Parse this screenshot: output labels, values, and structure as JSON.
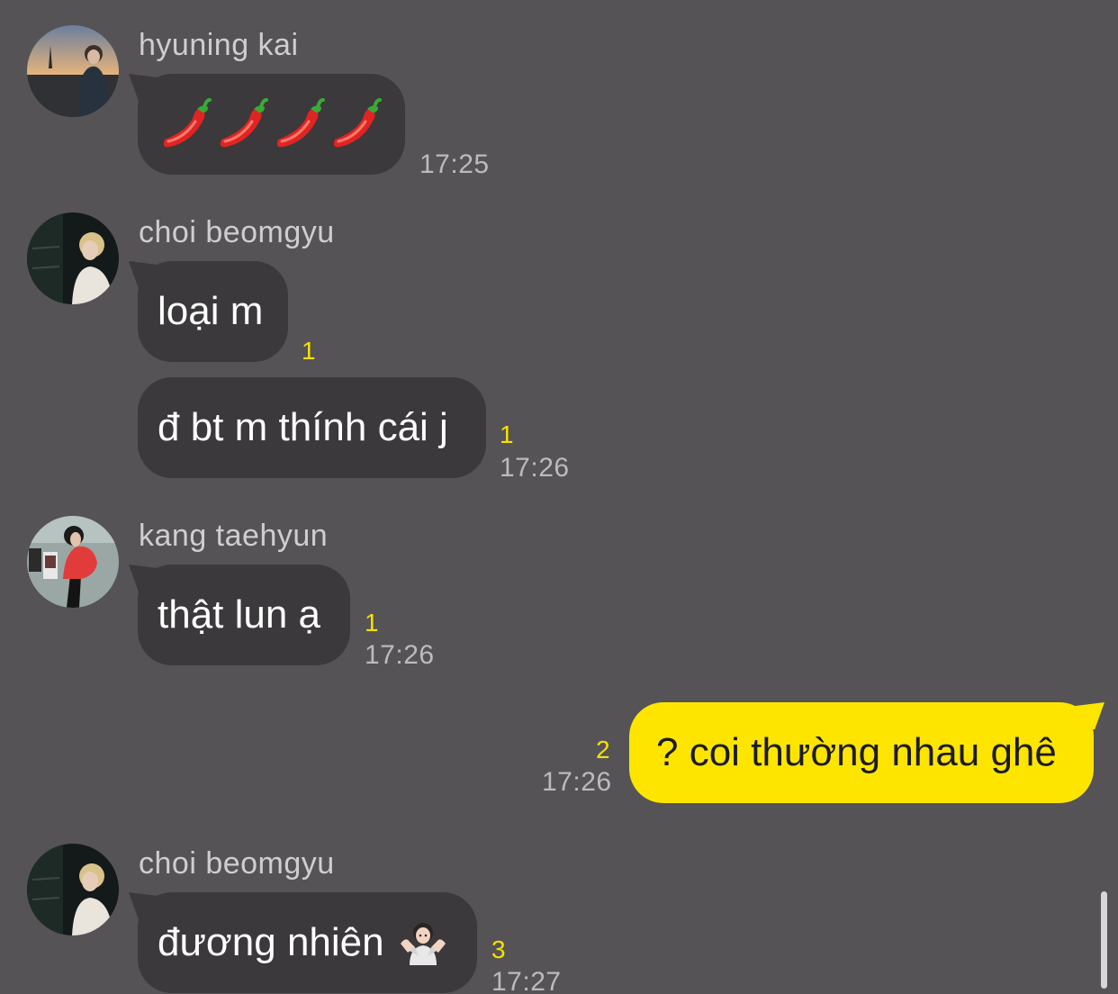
{
  "messages": [
    {
      "sender": "hyuning kai",
      "avatar_icon": "avatar-photo-icon",
      "bubbles": [
        {
          "text": "🌶️🌶️🌶️🌶️",
          "emoji": "chili-pepper-icon",
          "emoji_count": 4,
          "unread": "",
          "time": "17:25"
        }
      ]
    },
    {
      "sender": "choi beomgyu",
      "avatar_icon": "avatar-photo-icon",
      "bubbles": [
        {
          "text": "loại m",
          "unread": "1",
          "time": ""
        },
        {
          "text": "đ bt m thính cái j",
          "unread": "1",
          "time": "17:26"
        }
      ]
    },
    {
      "sender": "kang taehyun",
      "avatar_icon": "avatar-photo-icon",
      "bubbles": [
        {
          "text": "thật lun ạ",
          "unread": "1",
          "time": "17:26"
        }
      ]
    },
    {
      "sender": "me",
      "bubbles": [
        {
          "text": "? coi thường nhau ghê",
          "unread": "2",
          "time": "17:26"
        }
      ]
    },
    {
      "sender": "choi beomgyu",
      "avatar_icon": "avatar-photo-icon",
      "bubbles": [
        {
          "text": "đương nhiên",
          "emoji": "person-shrugging-icon",
          "unread": "3",
          "time": "17:27"
        }
      ]
    }
  ],
  "colors": {
    "background": "#555355",
    "incoming_bubble": "#3b393b",
    "outgoing_bubble": "#fee500",
    "unread_count": "#f7e100"
  }
}
